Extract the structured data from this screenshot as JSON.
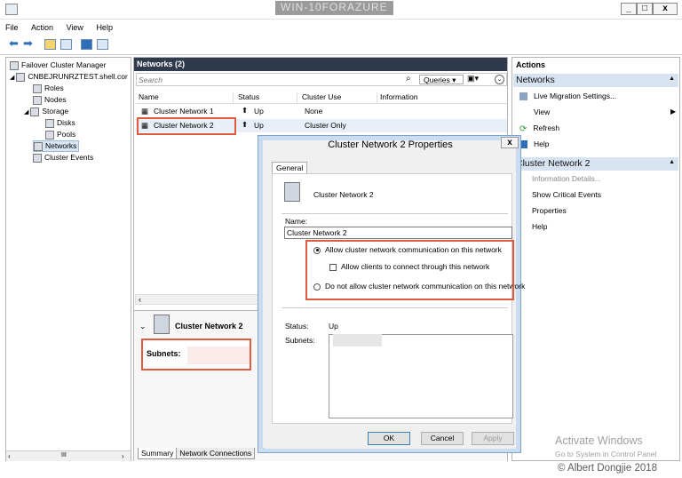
{
  "window": {
    "title": "WIN-10FORAZURE",
    "controls": [
      "_",
      "□",
      "x"
    ]
  },
  "menu": [
    "File",
    "Action",
    "View",
    "Help"
  ],
  "tree": {
    "items": [
      {
        "label": "Failover Cluster Manager",
        "icon": "cluster-manager-icon"
      },
      {
        "label": "CNBEJRUNRZTEST.shell.cor",
        "icon": "cluster-icon"
      },
      {
        "label": "Roles",
        "icon": "roles-icon"
      },
      {
        "label": "Nodes",
        "icon": "nodes-icon"
      },
      {
        "label": "Storage",
        "icon": "storage-icon"
      },
      {
        "label": "Disks",
        "icon": "disks-icon"
      },
      {
        "label": "Pools",
        "icon": "pools-icon"
      },
      {
        "label": "Networks",
        "icon": "networks-icon"
      },
      {
        "label": "Cluster Events",
        "icon": "events-icon"
      }
    ],
    "scroll_mid": "III"
  },
  "networks": {
    "header": "Networks (2)",
    "search_placeholder": "Search",
    "queries_label": "Queries",
    "columns": [
      "Name",
      "Status",
      "Cluster Use",
      "Information"
    ],
    "rows": [
      {
        "name": "Cluster Network 1",
        "status": "Up",
        "use": "None",
        "info": ""
      },
      {
        "name": "Cluster Network 2",
        "status": "Up",
        "use": "Cluster Only",
        "info": ""
      }
    ]
  },
  "detail": {
    "title": "Cluster Network 2",
    "subnets_label": "Subnets:",
    "tabs": [
      "Summary",
      "Network Connections"
    ]
  },
  "actions": {
    "header": "Actions",
    "section1": "Networks",
    "section1_items": [
      "Live Migration Settings...",
      "View",
      "Refresh",
      "Help"
    ],
    "section2": "Cluster Network 2",
    "section2_items": [
      "Information Details...",
      "Show Critical Events",
      "Properties",
      "Help"
    ]
  },
  "dialog": {
    "title": "Cluster Network 2 Properties",
    "close": "x",
    "tab": "General",
    "network_name": "Cluster Network 2",
    "name_label": "Name:",
    "name_value": "Cluster Network 2",
    "opt_allow": "Allow cluster network communication on this network",
    "opt_clients": "Allow clients to connect through this network",
    "opt_deny": "Do not allow cluster network communication on this network",
    "status_label": "Status:",
    "status_value": "Up",
    "subnets_label": "Subnets:",
    "ok": "OK",
    "cancel": "Cancel",
    "apply": "Apply"
  },
  "watermark": {
    "activate": "Activate Windows",
    "activate_sub": "Go to System in Control Panel",
    "copyright": "© Albert Dongjie 2018"
  }
}
